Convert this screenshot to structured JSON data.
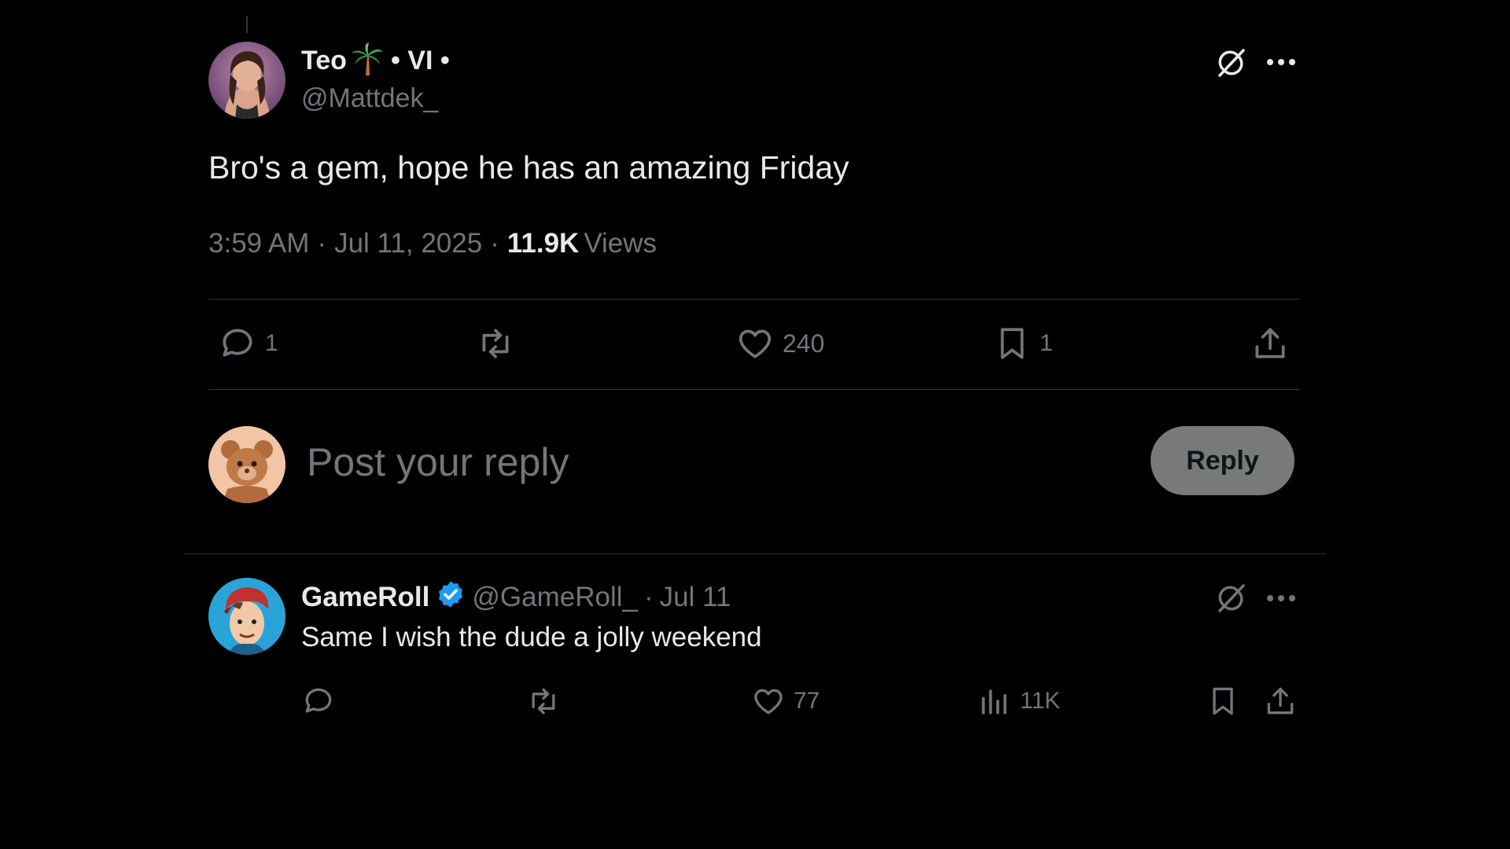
{
  "main_post": {
    "display_name": "Teo",
    "name_suffix": "• VI •",
    "handle": "@Mattdek_",
    "text": "Bro's a gem, hope he has an amazing Friday",
    "time": "3:59 AM",
    "date": "Jul 11, 2025",
    "views_count": "11.9K",
    "views_label": "Views",
    "actions": {
      "replies": "1",
      "likes": "240",
      "bookmarks": "1"
    }
  },
  "composer": {
    "placeholder": "Post your reply",
    "reply_button": "Reply"
  },
  "reply_post": {
    "display_name": "GameRoll",
    "handle": "@GameRoll_",
    "date": "Jul 11",
    "text": "Same I wish the dude a jolly weekend",
    "actions": {
      "likes": "77",
      "views": "11K"
    }
  },
  "colors": {
    "background": "#000000",
    "text": "#e7e9ea",
    "muted": "#71767b",
    "divider": "#2f3336",
    "verified": "#1d9bf0",
    "reply_button_bg": "#787a7a"
  },
  "icons": [
    "grok-icon",
    "more-icon",
    "reply-icon",
    "repost-icon",
    "like-icon",
    "bookmark-icon",
    "share-icon",
    "views-icon",
    "verified-badge-icon",
    "palm-tree-emoji"
  ]
}
